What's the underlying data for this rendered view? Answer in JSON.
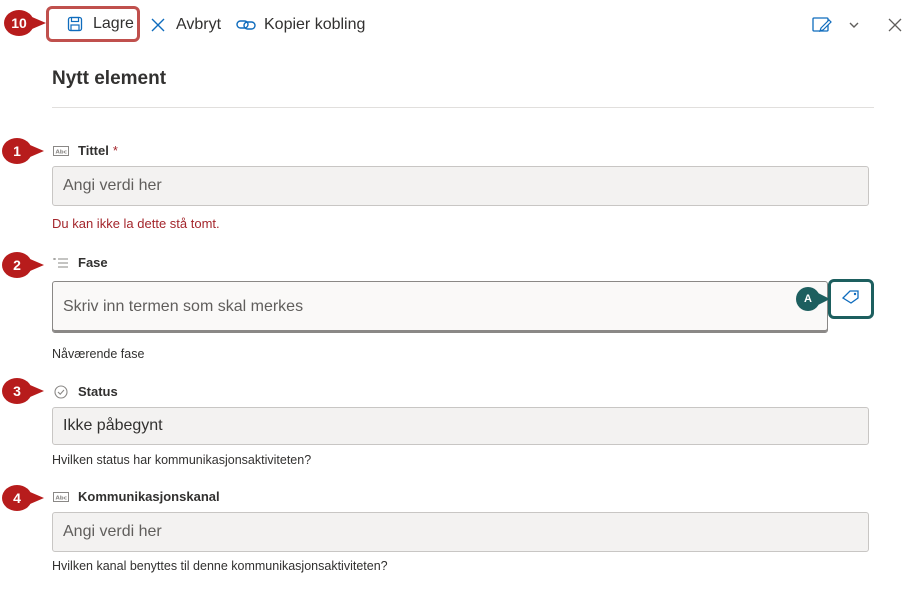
{
  "toolbar": {
    "save_label": "Lagre",
    "cancel_label": "Avbryt",
    "copy_link_label": "Kopier kobling",
    "save_callout": "10"
  },
  "form": {
    "title": "Nytt element",
    "fields": [
      {
        "callout": "1",
        "label": "Tittel",
        "required_marker": "*",
        "placeholder": "Angi verdi her",
        "error": "Du kan ikke la dette stå tomt.",
        "icon": "text-field-icon"
      },
      {
        "callout": "2",
        "label": "Fase",
        "placeholder": "Skriv inn termen som skal merkes",
        "help": "Nåværende fase",
        "icon": "managed-metadata-icon",
        "term_callout": "A",
        "term_button_icon": "tag-icon"
      },
      {
        "callout": "3",
        "label": "Status",
        "value": "Ikke påbegynt",
        "help": "Hvilken status har kommunikasjonsaktiviteten?",
        "icon": "choice-check-icon"
      },
      {
        "callout": "4",
        "label": "Kommunikasjonskanal",
        "placeholder": "Angi verdi her",
        "help": "Hvilken kanal benyttes til denne kommunikasjonsaktiviteten?",
        "icon": "text-field-icon"
      }
    ]
  },
  "colors": {
    "callout_red": "#b71c1c",
    "callout_teal": "#1d5f5f",
    "error_red": "#a4262c",
    "link_blue": "#0f6cbd"
  }
}
